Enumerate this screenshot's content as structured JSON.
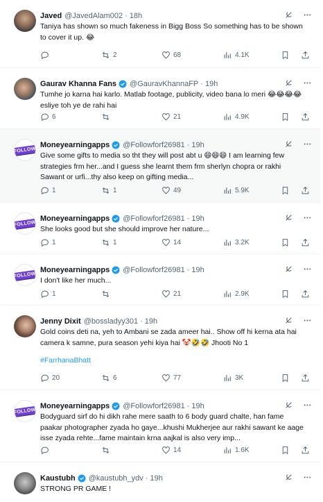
{
  "tweets": [
    {
      "name": "Javed",
      "verified": false,
      "handle": "@JavedAlam002",
      "time": "18h",
      "text": "Taniya has shown so much fakeness in Bigg Boss So something has to be shown to cover it up. 😂",
      "hashtag": "",
      "replies": "",
      "retweets": "2",
      "likes": "68",
      "views": "4.1K"
    },
    {
      "name": "Gaurav Khanna Fans",
      "verified": true,
      "handle": "@GauravKhannaFP",
      "time": "19h",
      "text": "Tumhe jo karna hai karlo. Matlab footage, publicity, video bana lo meri 😂😂😂😂 esliye toh ye de rahi hai",
      "hashtag": "",
      "replies": "6",
      "retweets": "",
      "likes": "21",
      "views": "4.9K"
    },
    {
      "name": "Moneyearningapps",
      "verified": true,
      "handle": "@Followforf26981",
      "time": "19h",
      "text": "Give some gifts to media so tht they will post abt u 😄😄😄 I am learning few strategies frm her...and I guess she learnt them frm sherlyn chopra or rakhi Sawant or urfi...thy also keep on gifting media...",
      "hashtag": "",
      "replies": "1",
      "retweets": "1",
      "likes": "49",
      "views": "5.9K"
    },
    {
      "name": "Moneyearningapps",
      "verified": true,
      "handle": "@Followforf26981",
      "time": "19h",
      "text": "She looks good but she should improve her nature...",
      "hashtag": "",
      "replies": "1",
      "retweets": "1",
      "likes": "14",
      "views": "3.2K"
    },
    {
      "name": "Moneyearningapps",
      "verified": true,
      "handle": "@Followforf26981",
      "time": "19h",
      "text": "I don't like her much...",
      "hashtag": "",
      "replies": "1",
      "retweets": "",
      "likes": "21",
      "views": "2.9K"
    },
    {
      "name": "Jenny Dixit",
      "verified": false,
      "handle": "@bossladyy301",
      "time": "19h",
      "text": "Gold coins deti na, yeh to Ambani se zada ameer hai.. Show off hi kerna ata hai camera k samne, pura season yehi kiya hai 🤡🤣🤣 Jhooti No 1",
      "hashtag": "#FarrhanaBhatt",
      "replies": "20",
      "retweets": "6",
      "likes": "77",
      "views": "3K"
    },
    {
      "name": "Moneyearningapps",
      "verified": true,
      "handle": "@Followforf26981",
      "time": "19h",
      "text": "Bodyguard sirf do hi dikh rahe mere saath to 6 body guard chalte, han fame paakar photographer zyada ho gaye...khushi Mukherjee aur rakhi sawant ke aage isse zyada rehte...fame maintain krna aajkal is also very imp...",
      "hashtag": "",
      "replies": "",
      "retweets": "",
      "likes": "14",
      "views": "1.6K"
    },
    {
      "name": "Kaustubh",
      "verified": true,
      "handle": "@kaustubh_ydv",
      "time": "19h",
      "text": "STRONG PR GAME !",
      "hashtag": "",
      "replies": "",
      "retweets": "",
      "likes": "",
      "views": ""
    }
  ]
}
